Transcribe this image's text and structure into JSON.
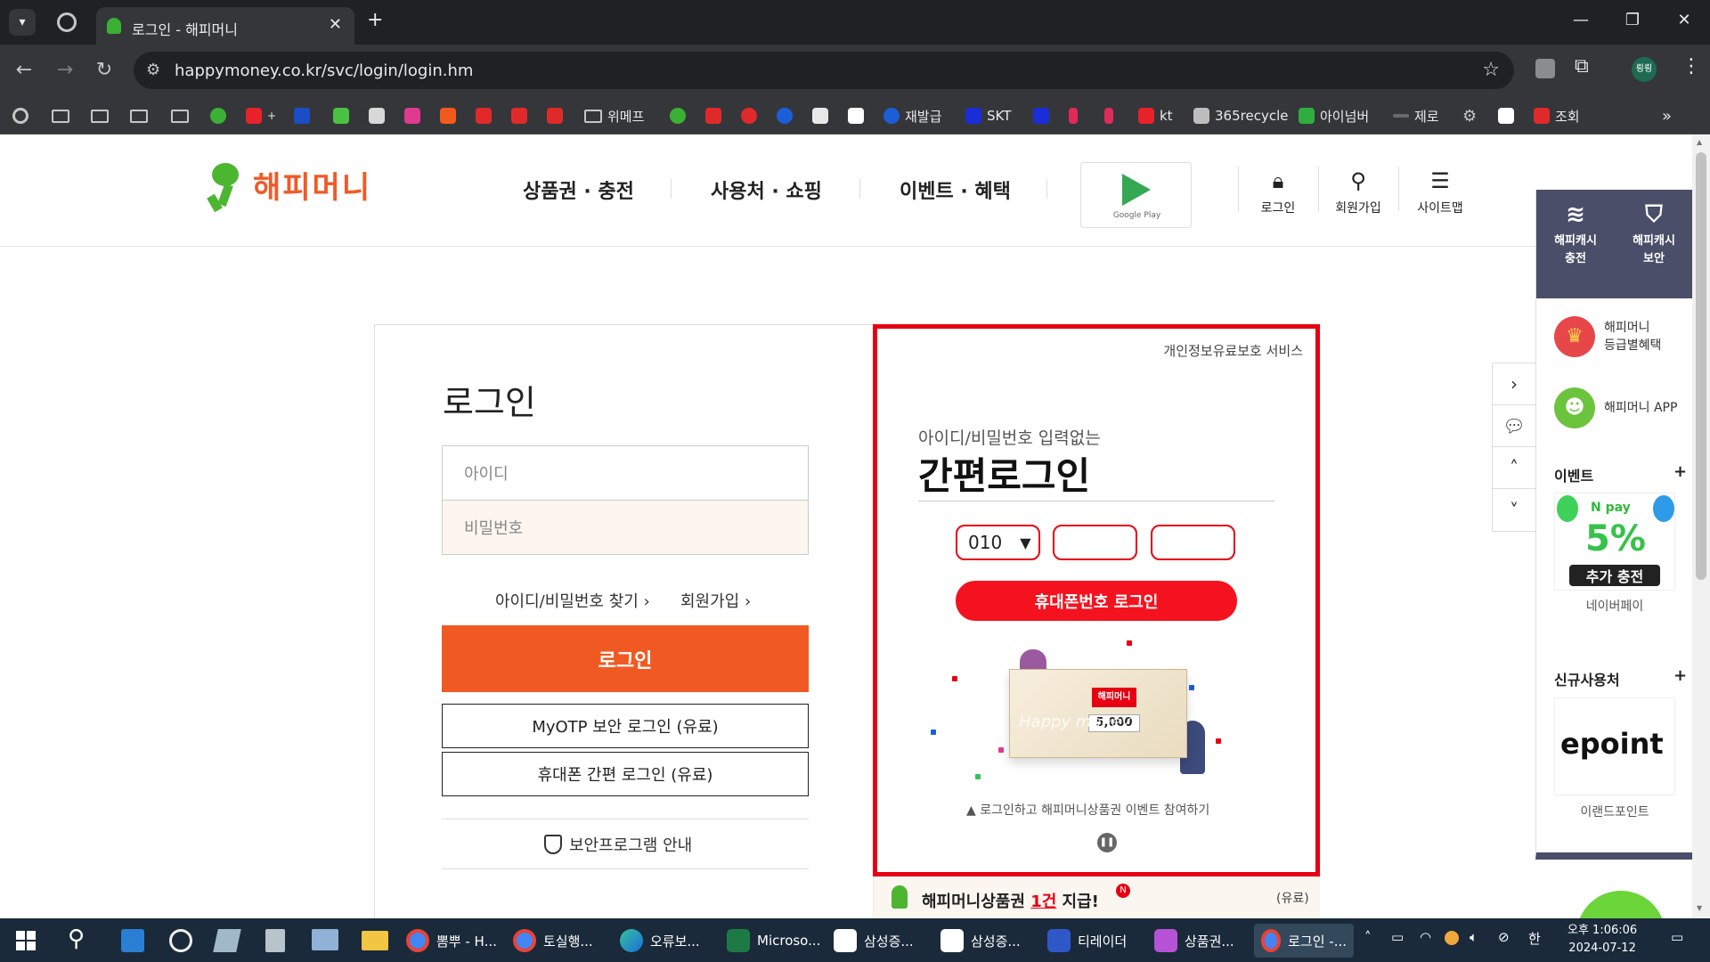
{
  "browser": {
    "tab_title": "로그인 - 해피머니",
    "url": "happymoney.co.kr/svc/login/login.hm",
    "profile": "릥릥",
    "bookmarks": [
      "위메프",
      "재발급",
      "SKT",
      "kt",
      "365recycle",
      "아이넘버",
      "제로",
      "조회"
    ]
  },
  "header": {
    "logo_text": "해피머니",
    "nav": [
      "상품권 · 충전",
      "사용처 · 쇼핑",
      "이벤트 · 혜택"
    ],
    "gplay_label": "Google Play",
    "utils": [
      "로그인",
      "회원가입",
      "사이트맵"
    ]
  },
  "login": {
    "title": "로그인",
    "id_placeholder": "아이디",
    "pw_placeholder": "비밀번호",
    "find_link": "아이디/비밀번호 찾기",
    "join_link": "회원가입",
    "login_button": "로그인",
    "otp_button": "MyOTP 보안 로그인 (유료)",
    "phone_button": "휴대폰 간편 로그인 (유료)",
    "security_guide": "보안프로그램 안내"
  },
  "ad": {
    "top_label": "개인정보유료보호 서비스",
    "subtitle": "아이디/비밀번호 입력없는",
    "title": "간편로그인",
    "phone_prefix": "010",
    "phone_login_button": "휴대폰번호 로그인",
    "voucher_brand": "해피머니",
    "voucher_amount": "5,000",
    "voucher_word": "Happy money",
    "event_text": "로그인하고 해피머니상품권 이벤트 참여하기",
    "bottom_text_a": "해피머니상품권 ",
    "bottom_text_b": "1건",
    "bottom_text_c": " 지급!",
    "bottom_paid": "(유료)"
  },
  "right_panel": {
    "charge": [
      "해피캐시",
      "충전"
    ],
    "security": [
      "해피캐시",
      "보안"
    ],
    "grade": [
      "해피머니",
      "등급별혜택"
    ],
    "app": "해피머니 APP",
    "event_head": "이벤트",
    "npay_text": "5%",
    "npay_sub": "추가 충전",
    "npay_caption": "네이버페이",
    "new_head": "신규사용처",
    "epoint_text": "epoint",
    "epoint_caption": "이랜드포인트"
  },
  "taskbar": {
    "items": [
      "뽐뿌 - H...",
      "토실행...",
      "오류보...",
      "Microso...",
      "삼성증...",
      "삼성증...",
      "티레이더",
      "상품권...",
      "로그인 -..."
    ],
    "ime": "한",
    "time_ampm": "오후 1:06:06",
    "date": "2024-07-12"
  },
  "colors": {
    "brand_orange": "#f05a22",
    "ad_red": "#e60012",
    "panel_navy": "#4a4e68"
  }
}
